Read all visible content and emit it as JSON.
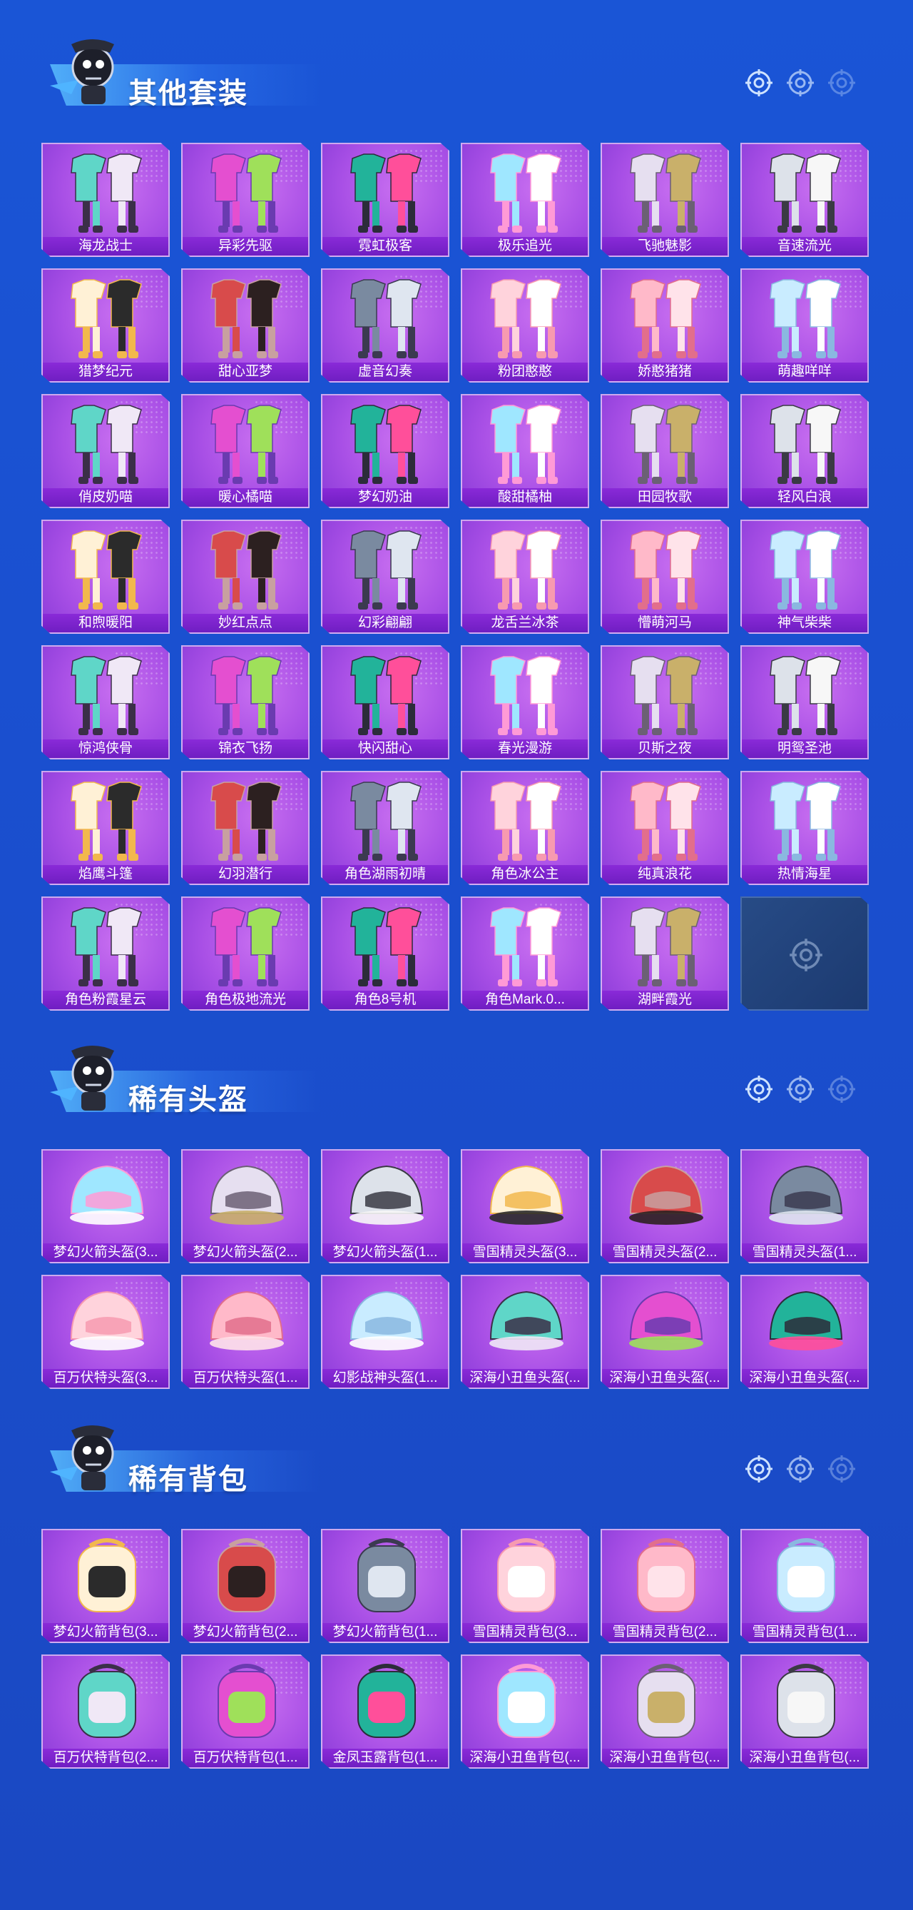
{
  "sections": [
    {
      "title": "其他套装",
      "items": [
        "海龙战士",
        "异彩先驱",
        "霓虹极客",
        "极乐追光",
        "飞驰魅影",
        "音速流光",
        "猎梦纪元",
        "甜心亚梦",
        "虚音幻奏",
        "粉团憨憨",
        "娇憨猪猪",
        "萌趣咩咩",
        "俏皮奶喵",
        "暖心橘喵",
        "梦幻奶油",
        "酸甜橘柚",
        "田园牧歌",
        "轻风白浪",
        "和煦暖阳",
        "妙红点点",
        "幻彩翩翩",
        "龙舌兰冰茶",
        "懵萌河马",
        "神气柴柴",
        "惊鸿侠骨",
        "锦衣飞扬",
        "快闪甜心",
        "春光漫游",
        "贝斯之夜",
        "明鸳圣池",
        "焰鹰斗篷",
        "幻羽潜行",
        "角色湖雨初晴",
        "角色冰公主",
        "纯真浪花",
        "热情海星",
        "角色粉霞星云",
        "角色极地流光",
        "角色8号机",
        "角色Mark.0...",
        "湖畔霞光"
      ]
    },
    {
      "title": "稀有头盔",
      "items": [
        "梦幻火箭头盔(3...",
        "梦幻火箭头盔(2...",
        "梦幻火箭头盔(1...",
        "雪国精灵头盔(3...",
        "雪国精灵头盔(2...",
        "雪国精灵头盔(1...",
        "百万伏特头盔(3...",
        "百万伏特头盔(1...",
        "幻影战神头盔(1...",
        "深海小丑鱼头盔(...",
        "深海小丑鱼头盔(...",
        "深海小丑鱼头盔(..."
      ]
    },
    {
      "title": "稀有背包",
      "items": [
        "梦幻火箭背包(3...",
        "梦幻火箭背包(2...",
        "梦幻火箭背包(1...",
        "雪国精灵背包(3...",
        "雪国精灵背包(2...",
        "雪国精灵背包(1...",
        "百万伏特背包(2...",
        "百万伏特背包(1...",
        "金凤玉露背包(1...",
        "深海小丑鱼背包(...",
        "深海小丑鱼背包(...",
        "深海小丑鱼背包(..."
      ]
    }
  ],
  "colors": {
    "background": "#1a55d6",
    "card": "#a950e6",
    "caption": "#7a24cc",
    "empty_slot": "#274b86"
  },
  "icons": {
    "section_mascot": "mascot-icon",
    "target": "crosshair-icon"
  }
}
